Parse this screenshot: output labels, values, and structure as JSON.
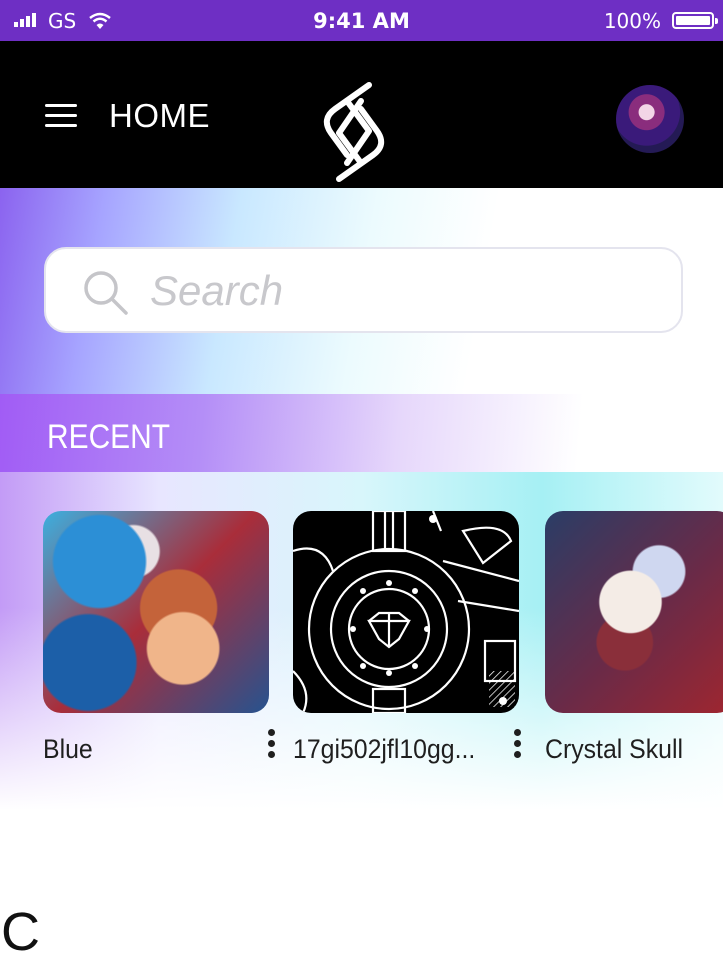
{
  "status_bar": {
    "carrier": "GS",
    "time": "9:41 AM",
    "battery": "100%"
  },
  "nav": {
    "title": "HOME",
    "icons": {
      "menu": "hamburger-menu-icon",
      "logo": "app-logo-s",
      "avatar": "user-avatar"
    }
  },
  "search": {
    "placeholder": "Search",
    "icon": "search-icon"
  },
  "recent": {
    "heading": "RECENT",
    "items": [
      {
        "title": "Blue",
        "thumb": "painted-portrait"
      },
      {
        "title": "17gi502jfl10gg...",
        "thumb": "geometric-diamond-art"
      },
      {
        "title": "Crystal Skull",
        "thumb": "crystal-skull-render"
      }
    ]
  },
  "stray_text": "C",
  "colors": {
    "status_bar_bg": "#6e2fc4",
    "nav_bg": "#000000",
    "accent_purple": "#a15cf5",
    "accent_cyan": "#a6f0f4"
  }
}
